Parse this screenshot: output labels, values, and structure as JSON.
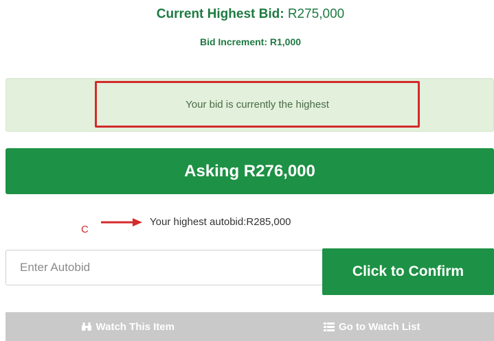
{
  "bid": {
    "current_label": "Current Highest Bid:",
    "current_amount": "R275,000",
    "increment_label": "Bid Increment:",
    "increment_amount": "R1,000"
  },
  "status": {
    "message": "Your bid is currently the highest"
  },
  "asking": {
    "label": "Asking R276,000"
  },
  "annotation": {
    "letter": "C"
  },
  "autobid": {
    "info": "Your highest autobid:R285,000",
    "placeholder": "Enter Autobid",
    "value": "",
    "confirm_label": "Click to Confirm"
  },
  "watch": {
    "watch_item_label": "Watch This Item",
    "watch_list_label": "Go to Watch List"
  },
  "colors": {
    "brand_green": "#1d9145",
    "success_bg": "#e2f0dc",
    "highlight_red": "#d42a2a",
    "disabled_gray": "#c9c9c9"
  },
  "icons": {
    "watch_item": "binoculars-icon",
    "watch_list": "list-icon",
    "annotation": "arrow-right-icon"
  }
}
